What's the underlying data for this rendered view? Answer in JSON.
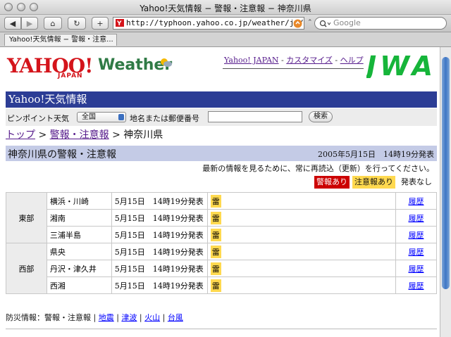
{
  "window": {
    "title": "Yahoo!天気情報 − 警報・注意報 − 神奈川県"
  },
  "toolbar": {
    "back": "◀",
    "forward": "▶",
    "home": "⌂",
    "reload": "↻",
    "add": "+",
    "url": "http://typhoon.yahoo.co.jp/weather/jp/keih",
    "search_placeholder": "Google"
  },
  "tab": {
    "label": "Yahoo!天気情報 − 警報・注意..."
  },
  "header": {
    "logo_yahoo": "YAHOO!",
    "logo_japan": "JAPAN",
    "logo_weather": "Weather",
    "links": {
      "yahoo_japan": "Yahoo! JAPAN",
      "customize": "カスタマイズ",
      "help": "ヘルプ",
      "sep": " - "
    },
    "jwa": "JWA"
  },
  "title_bar": "Yahoo!天気情報",
  "search": {
    "pinpoint_label": "ピンポイント天気",
    "select_value": "全国",
    "place_label": "地名または郵便番号",
    "input_value": "",
    "button": "検索"
  },
  "breadcrumb": {
    "top": "トップ",
    "warnings": "警報・注意報",
    "current": "神奈川県",
    "sep": " > "
  },
  "section": {
    "title": "神奈川県の警報・注意報",
    "issued": "2005年5月15日　14時19分発表"
  },
  "reload_notice": "最新の情報を見るために、常に再読込（更新）を行ってください。",
  "legend": {
    "warning": "警報あり",
    "advisory": "注意報あり",
    "none": "発表なし",
    "warning_color": "#cc0000",
    "advisory_color": "#ffd94f"
  },
  "regions": [
    {
      "name": "東部",
      "areas": [
        {
          "name": "横浜・川崎",
          "date": "5月15日",
          "time": "14時19分発表",
          "type": "雷",
          "history": "履歴"
        },
        {
          "name": "湘南",
          "date": "5月15日",
          "time": "14時19分発表",
          "type": "雷",
          "history": "履歴"
        },
        {
          "name": "三浦半島",
          "date": "5月15日",
          "time": "14時19分発表",
          "type": "雷",
          "history": "履歴"
        }
      ]
    },
    {
      "name": "西部",
      "areas": [
        {
          "name": "県央",
          "date": "5月15日",
          "time": "14時19分発表",
          "type": "雷",
          "history": "履歴"
        },
        {
          "name": "丹沢・津久井",
          "date": "5月15日",
          "time": "14時19分発表",
          "type": "雷",
          "history": "履歴"
        },
        {
          "name": "西湘",
          "date": "5月15日",
          "time": "14時19分発表",
          "type": "雷",
          "history": "履歴"
        }
      ]
    }
  ],
  "footer": {
    "label": "防災情報：警報・注意報",
    "sep": " | ",
    "links": [
      "地震",
      "津波",
      "火山",
      "台風"
    ]
  }
}
